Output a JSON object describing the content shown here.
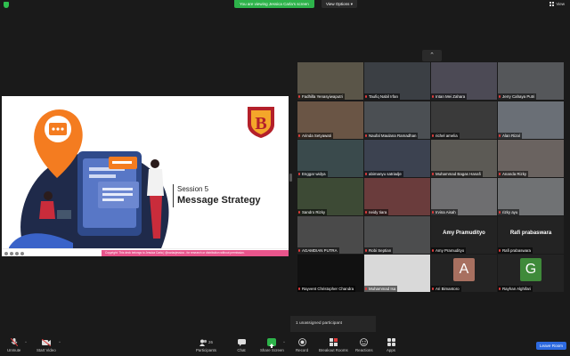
{
  "topbar": {
    "banner": "You are viewing Jessica Carla's screen",
    "view_options": "View Options",
    "view_button": "View"
  },
  "slide": {
    "session_label": "Session 5",
    "session_title": "Message Strategy",
    "copyright": "Copyright: This deck belongs to Jessica Carla | @carlacjessica - for research or distribution without permission.",
    "accent_color": "#f47c20",
    "logo_color": "#b4202a",
    "logo_letter": "B"
  },
  "gallery": {
    "tiles": [
      {
        "name": "Fadhilla Yenasyiwaputri",
        "bg": "#5a5548"
      },
      {
        "name": "Taufiq Nabil Irfan",
        "bg": "#3b3f44"
      },
      {
        "name": "Intan Mei Zahara",
        "bg": "#4c4a55"
      },
      {
        "name": "Jerry Cahaya Putri",
        "bg": "#55575a"
      },
      {
        "name": "Arinda Setyawati",
        "bg": "#6a5545"
      },
      {
        "name": "Naufal Maulana Ramadhan",
        "bg": "#4b4f53"
      },
      {
        "name": "richel amelia",
        "bg": "#3a3a3a"
      },
      {
        "name": "Alan Rizal",
        "bg": "#6a6f76"
      },
      {
        "name": "Enggar widya",
        "bg": "#3a4a4c"
      },
      {
        "name": "abimanyu satriadje",
        "bg": "#3c4250"
      },
      {
        "name": "Muhammad Bagas Hanafi",
        "bg": "#5c5a55"
      },
      {
        "name": "Ananda Rizky",
        "bg": "#6a6360"
      },
      {
        "name": "Sandro Rizky",
        "bg": "#3d4a35"
      },
      {
        "name": "neidy tiara",
        "bg": "#6a3c3c"
      },
      {
        "name": "Irvina Aisah",
        "bg": "#6e6e70"
      },
      {
        "name": "rizky ayu",
        "bg": "#707274"
      },
      {
        "name": "AGAMDIAN PUTRA",
        "bg": "#4a4a4a"
      },
      {
        "name": "Robi Septian",
        "bg": "#4c4d4e"
      },
      {
        "name": "Amy Pramudityo",
        "big_name": "Amy Pramudityo",
        "bg": "#232323"
      },
      {
        "name": "Rafi prabaswara",
        "big_name": "Rafi prabaswara",
        "bg": "#232323"
      },
      {
        "name": "Rayvent Christopher Chandra",
        "bg": "#111111"
      },
      {
        "name": "Muhammad Isa",
        "bg": "#d9d9d9"
      },
      {
        "name": "Ari Bimantoro",
        "letter": "A",
        "letter_bg": "#a87060",
        "bg": "#232323"
      },
      {
        "name": "Rayhan Alghifari",
        "letter": "G",
        "letter_bg": "#3f8a3a",
        "bg": "#232323"
      }
    ]
  },
  "unassigned": "1 unassigned participant",
  "toolbar": {
    "unmute": "Unmute",
    "start_video": "Start Video",
    "participants": "Participants",
    "participants_count": "26",
    "chat": "Chat",
    "share_screen": "Share Screen",
    "record": "Record",
    "breakout_rooms": "Breakout Rooms",
    "reactions": "Reactions",
    "apps": "Apps",
    "leave_room": "Leave Room"
  }
}
